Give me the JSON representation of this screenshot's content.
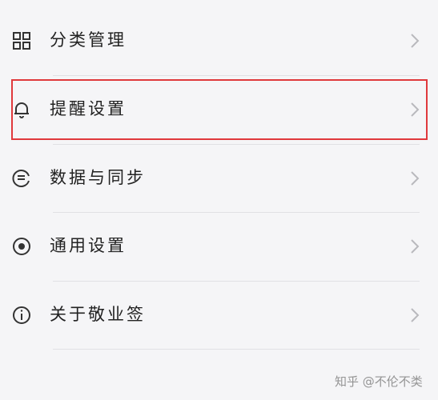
{
  "menu": {
    "items": [
      {
        "label": "分类管理",
        "icon": "grid-icon"
      },
      {
        "label": "提醒设置",
        "icon": "bell-icon"
      },
      {
        "label": "数据与同步",
        "icon": "sync-icon"
      },
      {
        "label": "通用设置",
        "icon": "radio-dot-icon"
      },
      {
        "label": "关于敬业签",
        "icon": "info-icon"
      }
    ]
  },
  "highlight": {
    "color": "#e0393c",
    "target": "提醒设置"
  },
  "watermark": {
    "text": "知乎 @不伦不类"
  }
}
